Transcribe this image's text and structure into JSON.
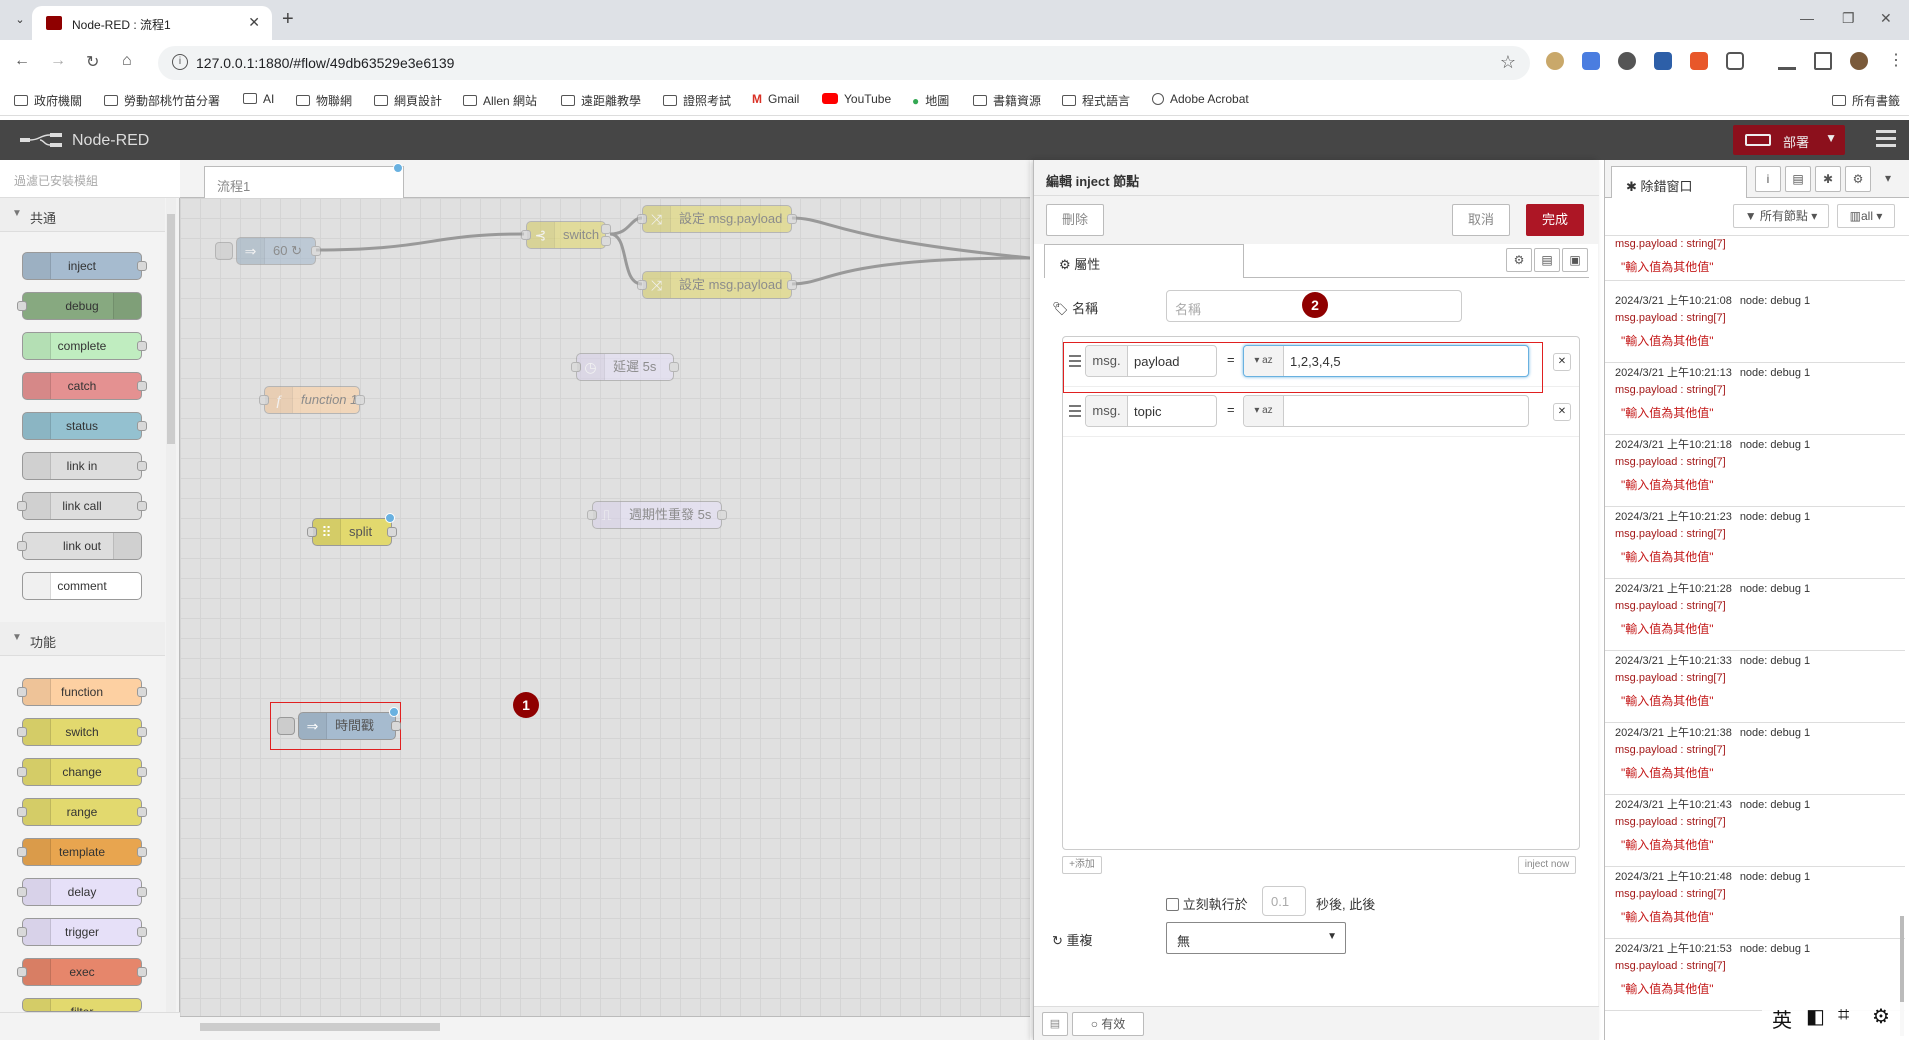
{
  "browser": {
    "tab_title": "Node-RED : 流程1",
    "url": "127.0.0.1:1880/#flow/49db63529e3e6139",
    "bookmarks": [
      "政府機關",
      "勞動部桃竹苗分署",
      "AI",
      "物聯網",
      "網頁設計",
      "Allen 網站",
      "遠距離教學",
      "證照考試",
      "Gmail",
      "YouTube",
      "地圖",
      "書籍資源",
      "程式語言",
      "Adobe Acrobat"
    ],
    "all_bookmarks": "所有書籤"
  },
  "header": {
    "app_name": "Node-RED",
    "deploy_label": "部署"
  },
  "palette": {
    "search_placeholder": "過濾已安裝模組",
    "categories": [
      {
        "label": "共通",
        "nodes": [
          "inject",
          "debug",
          "complete",
          "catch",
          "status",
          "link in",
          "link call",
          "link out",
          "comment"
        ]
      },
      {
        "label": "功能",
        "nodes": [
          "function",
          "switch",
          "change",
          "range",
          "template",
          "delay",
          "trigger",
          "exec",
          "filter"
        ]
      }
    ]
  },
  "workspace": {
    "tab": "流程1",
    "nodes": {
      "inject60": "60 ↻",
      "switch": "switch",
      "change1": "設定 msg.payload",
      "change2": "設定 msg.payload",
      "delay": "延遲 5s",
      "function": "function 1",
      "split": "split",
      "trigger": "週期性重發 5s",
      "timestamp": "時間戳"
    },
    "badge1": "1"
  },
  "tray": {
    "title": "編輯 inject 節點",
    "delete_label": "刪除",
    "cancel_label": "取消",
    "done_label": "完成",
    "props_tab": "屬性",
    "name_label": "名稱",
    "name_placeholder": "名稱",
    "badge2": "2",
    "props": [
      {
        "prefix": "msg.",
        "key": "payload",
        "type": "az",
        "value": "1,2,3,4,5"
      },
      {
        "prefix": "msg.",
        "key": "topic",
        "type": "az",
        "value": ""
      }
    ],
    "add_label": "添加",
    "inject_now_label": "inject now",
    "once_label": "立刻執行於",
    "once_value": "0.1",
    "once_suffix": "秒後, 此後",
    "repeat_label": "重複",
    "repeat_value": "無",
    "enabled_label": "有效"
  },
  "sidebar": {
    "tab_label": "除錯窗口",
    "filter_label": "所有節點",
    "clear_label": "all",
    "messages": [
      {
        "time": "",
        "node": "",
        "path": "msg.payload : string[7]",
        "value": "\"輸入值為其他值\""
      },
      {
        "time": "2024/3/21 上午10:21:08",
        "node": "node: debug 1",
        "path": "msg.payload : string[7]",
        "value": "\"輸入值為其他值\""
      },
      {
        "time": "2024/3/21 上午10:21:13",
        "node": "node: debug 1",
        "path": "msg.payload : string[7]",
        "value": "\"輸入值為其他值\""
      },
      {
        "time": "2024/3/21 上午10:21:18",
        "node": "node: debug 1",
        "path": "msg.payload : string[7]",
        "value": "\"輸入值為其他值\""
      },
      {
        "time": "2024/3/21 上午10:21:23",
        "node": "node: debug 1",
        "path": "msg.payload : string[7]",
        "value": "\"輸入值為其他值\""
      },
      {
        "time": "2024/3/21 上午10:21:28",
        "node": "node: debug 1",
        "path": "msg.payload : string[7]",
        "value": "\"輸入值為其他值\""
      },
      {
        "time": "2024/3/21 上午10:21:33",
        "node": "node: debug 1",
        "path": "msg.payload : string[7]",
        "value": "\"輸入值為其他值\""
      },
      {
        "time": "2024/3/21 上午10:21:38",
        "node": "node: debug 1",
        "path": "msg.payload : string[7]",
        "value": "\"輸入值為其他值\""
      },
      {
        "time": "2024/3/21 上午10:21:43",
        "node": "node: debug 1",
        "path": "msg.payload : string[7]",
        "value": "\"輸入值為其他值\""
      },
      {
        "time": "2024/3/21 上午10:21:48",
        "node": "node: debug 1",
        "path": "msg.payload : string[7]",
        "value": "\"輸入值為其他值\""
      },
      {
        "time": "2024/3/21 上午10:21:53",
        "node": "node: debug 1",
        "path": "msg.payload : string[7]",
        "value": "\"輸入值為其他值\""
      }
    ]
  },
  "ime": {
    "lang": "英"
  },
  "colors": {
    "accent": "#ad1625",
    "header": "#464646",
    "inject": "#a6bbcf",
    "debug": "#87a980",
    "function": "#fdd0a2",
    "change": "#e2d96e",
    "delay": "#e6e0f8"
  }
}
